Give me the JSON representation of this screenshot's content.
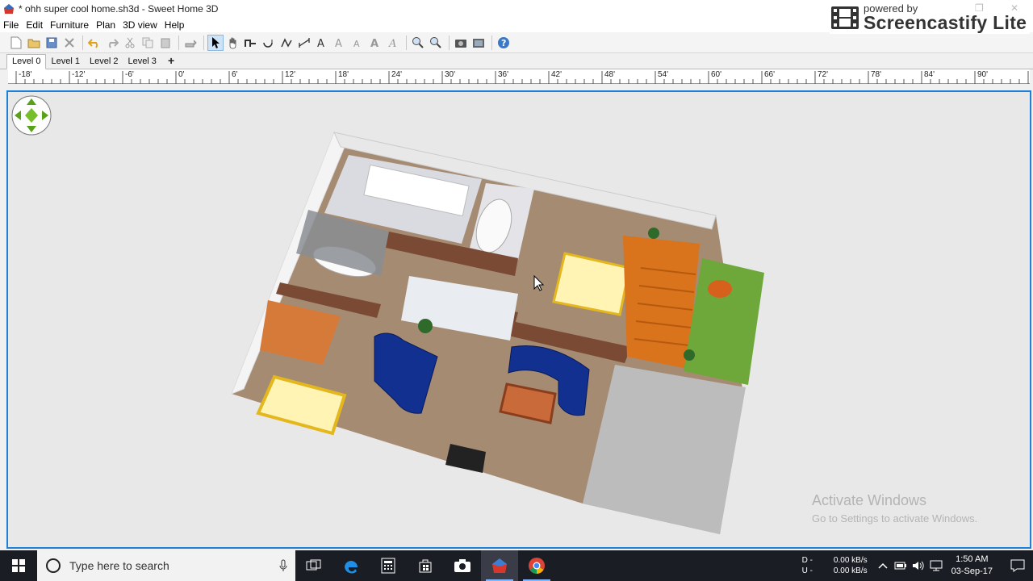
{
  "window": {
    "title": "* ohh super cool home.sh3d - Sweet Home 3D"
  },
  "overlay": {
    "powered_by": "powered by",
    "brand": "Screencastify Lite"
  },
  "menu": [
    "File",
    "Edit",
    "Furniture",
    "Plan",
    "3D view",
    "Help"
  ],
  "toolbar": {
    "buttons": [
      "new-file-icon",
      "open-file-icon",
      "save-icon",
      "cut-tool-icon",
      "undo-icon",
      "redo-icon",
      "cut-icon",
      "copy-icon",
      "paste-icon",
      "add-furniture-icon",
      "select-cursor-icon",
      "pan-hand-icon",
      "create-walls-icon",
      "create-rooms-icon",
      "create-polylines-icon",
      "create-dimensions-icon",
      "add-text-icon",
      "increase-text-icon",
      "decrease-text-icon",
      "bold-text-icon",
      "italic-text-icon",
      "zoom-in-icon",
      "zoom-out-icon",
      "create-photo-icon",
      "create-video-icon",
      "help-icon"
    ]
  },
  "levels": {
    "tabs": [
      "Level 0",
      "Level 1",
      "Level 2",
      "Level 3"
    ],
    "selected": "Level 0",
    "add_label": "+"
  },
  "ruler": {
    "labels": [
      "-18'",
      "-12'",
      "-6'",
      "0'",
      "6'",
      "12'",
      "18'",
      "24'",
      "30'",
      "36'",
      "42'",
      "48'",
      "54'",
      "60'",
      "66'",
      "72'",
      "78'",
      "84'",
      "90'"
    ]
  },
  "watermark": {
    "title": "Activate Windows",
    "subtitle": "Go to Settings to activate Windows."
  },
  "taskbar": {
    "search_placeholder": "Type here to search",
    "apps": [
      "task-view-icon",
      "edge-icon",
      "calculator-icon",
      "store-icon",
      "camera-icon",
      "sweet-home-3d-icon",
      "chrome-icon"
    ],
    "network": {
      "down_label": "D -",
      "up_label": "U -",
      "down_speed": "0.00 kB/s",
      "up_speed": "0.00 kB/s"
    },
    "time": "1:50 AM",
    "date": "03-Sep-17"
  },
  "colors": {
    "accent": "#1e7fd6",
    "taskbar": "#1b1d24",
    "floor": "#a08770",
    "grass": "#6ea83a",
    "sofa": "#0f2a8a"
  }
}
